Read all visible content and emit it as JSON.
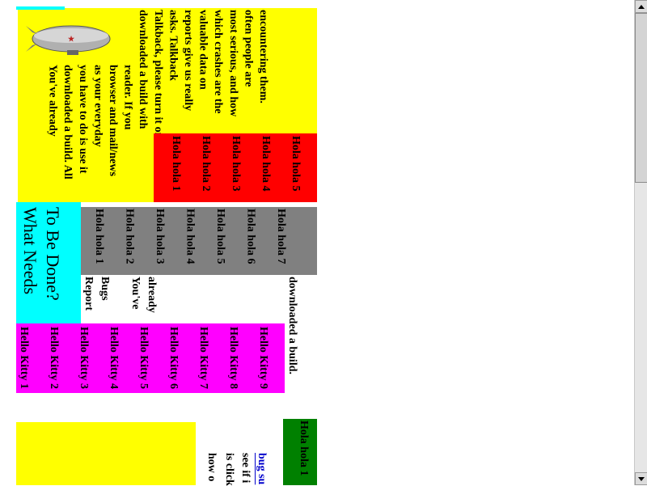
{
  "colors": {
    "yellow": "#ffff00",
    "cyan": "#00ffff",
    "red": "#ff0000",
    "gray": "#808080",
    "magenta": "#ff00ff",
    "green": "#008000",
    "link": "#0000cc"
  },
  "yellow_paragraph": [
    "encountering them.",
    "often people are",
    "most serious, and how",
    "which crashes are the",
    "valuable data on",
    "reports give us really",
    "asks. Talkback",
    "Talkback, please turn it on when it",
    "downloaded a build with",
    "reader. If you",
    "browser and mail/news",
    "as your everyday",
    "you have to do is use it",
    "downloaded a build. All",
    "You've already"
  ],
  "red_items": [
    "Hola hola 5",
    "Hola hola 4",
    "Hola hola 3",
    "Hola hola 2",
    "Hola hola 1"
  ],
  "gray_items": [
    "Hola hola 7",
    "Hola hola 6",
    "Hola hola 5",
    "Hola hola 4",
    "Hola hola 3",
    "Hola hola 2",
    "Hola hola 1"
  ],
  "white_lines": [
    "downloaded a build.",
    "already",
    "You've",
    "Bugs",
    "Report"
  ],
  "heading": {
    "line1": "To Be Done?",
    "line2": "What Needs"
  },
  "magenta_items": [
    "Hello Kitty 9",
    "Hello Kitty 8",
    "Hello Kitty 7",
    "Hello Kitty 6",
    "Hello Kitty 5",
    "Hello Kitty 4",
    "Hello Kitty 3",
    "Hello Kitty 2",
    "Hello Kitty 1"
  ],
  "green_item": "Hola hola 1",
  "lower_text": {
    "link": "bug su",
    "line2": "see if i",
    "line3": "is click",
    "line4": "how o"
  },
  "icons": {
    "airship": "airship-image"
  }
}
